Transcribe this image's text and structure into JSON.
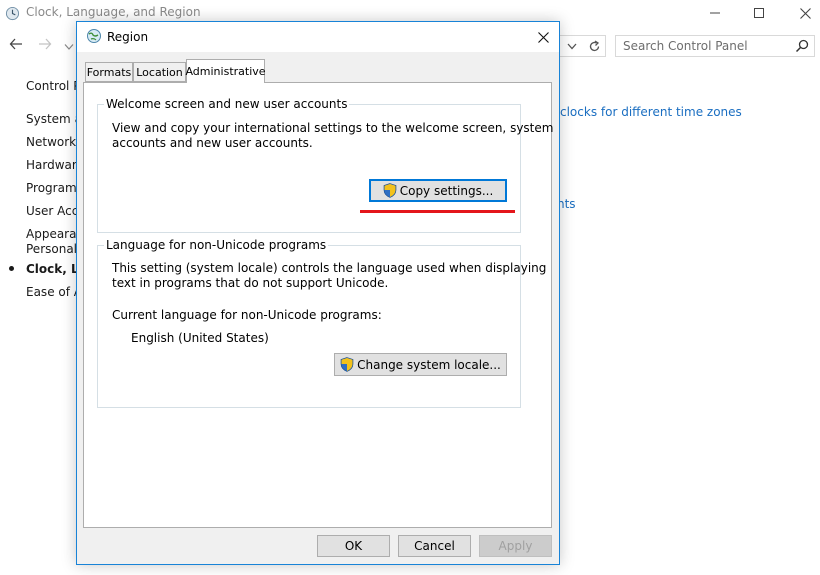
{
  "control_panel": {
    "window_title": "Clock, Language, and Region",
    "search_placeholder": "Search Control Panel",
    "sidebar": {
      "home": "Control P",
      "items": [
        "System a",
        "Network a",
        "Hardware",
        "Programs",
        "User Acco",
        "Appearan",
        "Personaliz",
        "Clock, Lan",
        "Ease of Ac"
      ]
    },
    "links": {
      "time_zones": "clocks for different time zones",
      "partial": "nts"
    }
  },
  "dialog": {
    "title": "Region",
    "tabs": [
      "Formats",
      "Location",
      "Administrative"
    ],
    "active_tab": "Administrative",
    "welcome_group": {
      "label": "Welcome screen and new user accounts",
      "text_line1": "View and copy your international settings to the welcome screen, system",
      "text_line2": "accounts and new user accounts.",
      "button": "Copy settings..."
    },
    "unicode_group": {
      "label": "Language for non-Unicode programs",
      "text_line1": "This setting (system locale) controls the language used when displaying",
      "text_line2": "text in programs that do not support Unicode.",
      "current_label": "Current language for non-Unicode programs:",
      "current_value": "English (United States)",
      "button": "Change system locale..."
    },
    "footer": {
      "ok": "OK",
      "cancel": "Cancel",
      "apply": "Apply"
    }
  },
  "colors": {
    "accent": "#0078d7",
    "link": "#1a6ec1",
    "annotation": "#e4161b",
    "dialog_bg": "#f0f0f0"
  },
  "icons": [
    "clock-globe-icon",
    "region-globe-icon",
    "uac-shield-icon",
    "search-icon",
    "close-icon",
    "minimize-icon",
    "maximize-icon",
    "back-arrow-icon",
    "forward-arrow-icon",
    "refresh-icon",
    "chevron-down-icon"
  ]
}
